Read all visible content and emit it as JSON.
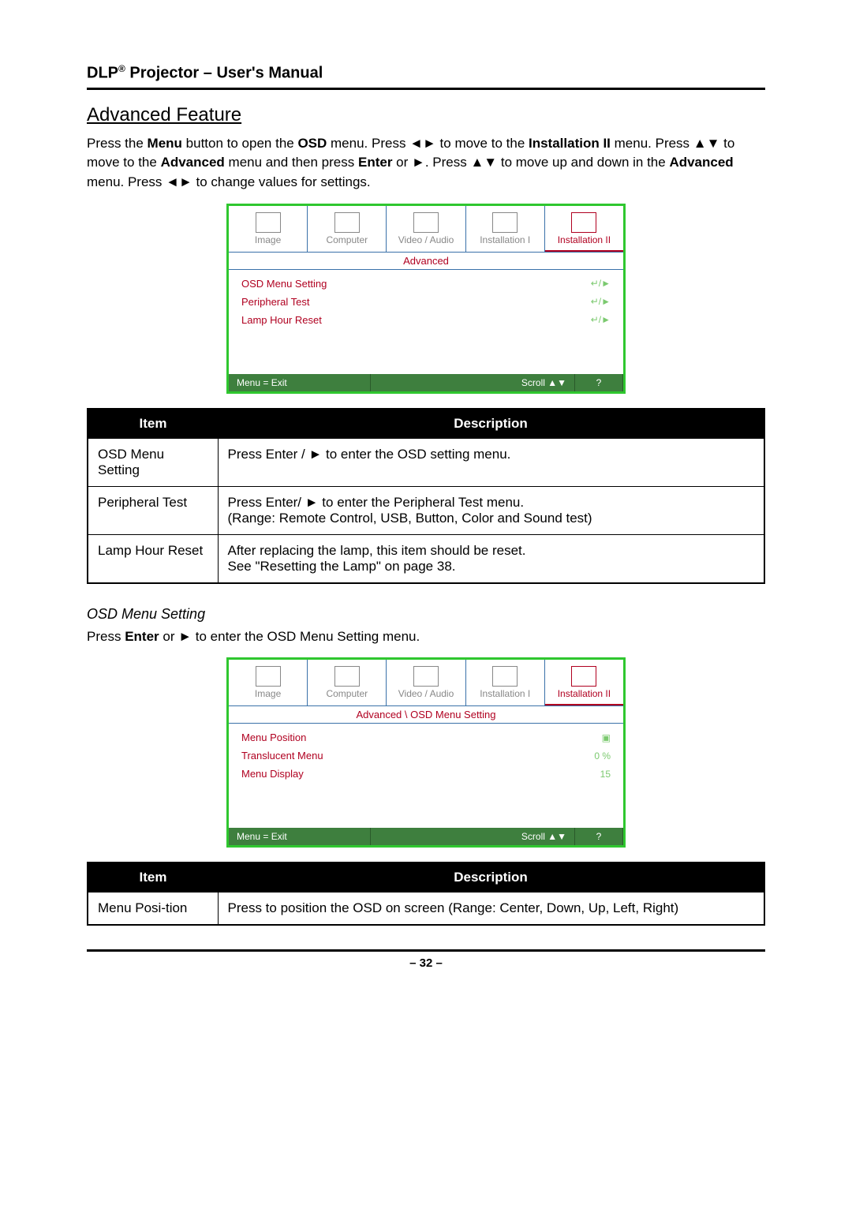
{
  "header": {
    "title_prefix": "DLP",
    "title_suffix": " Projector – User's Manual"
  },
  "section1": {
    "title": "Advanced Feature",
    "para_parts": {
      "t1": "Press the ",
      "t2": "Menu",
      "t3": " button to open the ",
      "t4": "OSD",
      "t5": " menu. Press ◄► to move to the ",
      "t6": "Installation II",
      "t7": " menu. Press ▲▼ to move to the ",
      "t8": "Advanced",
      "t9": " menu and then press ",
      "t10": "Enter",
      "t11": " or ►. Press ▲▼ to move up and down in the ",
      "t12": "Advanced",
      "t13": " menu. Press ◄► to change values for settings."
    }
  },
  "osd1": {
    "tabs": [
      "Image",
      "Computer",
      "Video / Audio",
      "Installation I",
      "Installation II"
    ],
    "active_tab": 4,
    "subtitle": "Advanced",
    "items": [
      {
        "label": "OSD Menu Setting",
        "icon": "↵/►"
      },
      {
        "label": "Peripheral Test",
        "icon": "↵/►"
      },
      {
        "label": "Lamp Hour Reset",
        "icon": "↵/►"
      }
    ],
    "footer": {
      "left": "Menu = Exit",
      "right": "Scroll ▲▼",
      "help": "?"
    }
  },
  "table1": {
    "headers": [
      "Item",
      "Description"
    ],
    "rows": [
      {
        "item": "OSD Menu Setting",
        "desc": "Press Enter / ► to enter the OSD setting menu."
      },
      {
        "item": "Peripheral Test",
        "desc": "Press Enter/ ► to enter the Peripheral Test menu.\n(Range: Remote Control, USB, Button, Color and Sound test)"
      },
      {
        "item": "Lamp Hour Reset",
        "desc": "After replacing the lamp, this item should be reset.\nSee \"Resetting the Lamp\" on page 38."
      }
    ]
  },
  "section2": {
    "heading": "OSD Menu Setting",
    "para_parts": {
      "t1": "Press ",
      "t2": "Enter",
      "t3": " or ► to enter the OSD Menu Setting menu."
    }
  },
  "osd2": {
    "tabs": [
      "Image",
      "Computer",
      "Video / Audio",
      "Installation I",
      "Installation II"
    ],
    "active_tab": 4,
    "subtitle": "Advanced \\ OSD Menu Setting",
    "items": [
      {
        "label": "Menu Position",
        "value": "▣"
      },
      {
        "label": "Translucent Menu",
        "value": "0 %"
      },
      {
        "label": "Menu Display",
        "value": "15"
      }
    ],
    "footer": {
      "left": "Menu = Exit",
      "right": "Scroll ▲▼",
      "help": "?"
    }
  },
  "table2": {
    "headers": [
      "Item",
      "Description"
    ],
    "rows": [
      {
        "item": "Menu Posi-tion",
        "desc": "Press to position the OSD on screen (Range: Center, Down, Up, Left, Right)"
      }
    ]
  },
  "page_number": "– 32 –"
}
